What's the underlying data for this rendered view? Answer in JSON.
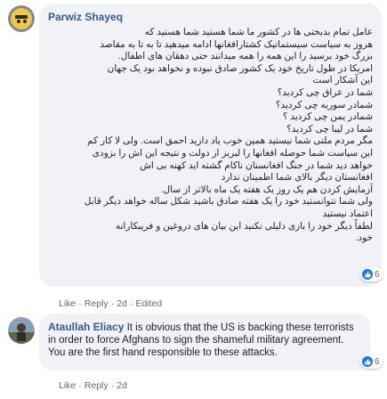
{
  "comments": [
    {
      "author": "Parwiz Shayeq",
      "text_lines": [
        "عامل تمام بدبختی ها در کشور ما شما هستید شما هستید که",
        "هروز به سیاست سیستماتیک کشتارافغانها ادامه میدهید تا به تا به مقاصد",
        "بزرگ خود برسید را این همه را همه میدانند حتی دهقان های اطفال.",
        "امریکا در طول تاریخ خود یک کشور صادق نبوده و نخواهد بود یک جهان",
        "این آشکار است",
        "شما در عراق چی کردید؟",
        "شمادر سوریه چی کردید؟",
        "شمادر یمن چی کردید ؟",
        "شما در لیبا چی کردید؟",
        "مگر مردم ملتی شما نیستید همین خوب یاد دارید احمق است. ولی لا کار کم",
        "این سیاست شما حوصله افغانها را لبریز از دولت و نتیجه این اش را بزودی",
        "خواهد دید شما در جنگ افغانستان ناکام گشته اید کهنه بی اش",
        "افغانستان دیگر بالای شما اطمینان ندارد",
        "آزمایش کردن هم یک روز یک هفته یک ماه بالاتر از سال.",
        "ولی شما نتوانستید خود را یک هفته صادق باشید شکل ساله خواهد دیگر قابل",
        "اعتماد نیستید",
        "لطفاً دیگر خود را بازی دلیلی نکنید این بیان های دروغین و فریبکارانه",
        "خود."
      ],
      "reaction_count": "6",
      "actions": {
        "like": "Like",
        "reply": "Reply",
        "time": "2d",
        "edited": "Edited"
      }
    },
    {
      "author": "Ataullah Eliacy",
      "text": "It is obvious that the US is backing these terrorists in order to force Afghans to sign the shameful military agreement. You are the first hand responsible to these attacks.",
      "reaction_count": "6",
      "actions": {
        "like": "Like",
        "reply": "Reply",
        "time": "2d"
      }
    }
  ],
  "colors": {
    "author": "#385898",
    "bubble": "#f0f2f5",
    "meta": "#65676b",
    "like_blue": "#1877f2"
  }
}
